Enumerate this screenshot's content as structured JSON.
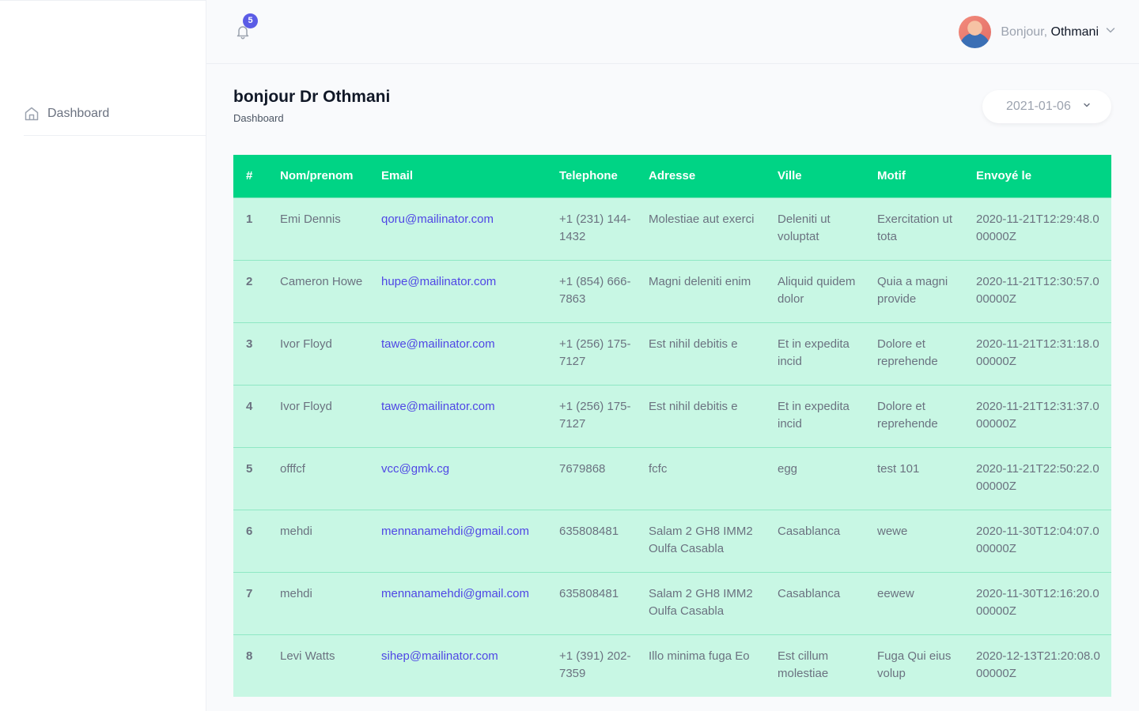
{
  "sidebar": {
    "items": [
      {
        "label": "Dashboard",
        "icon": "home-icon"
      }
    ]
  },
  "topbar": {
    "notification_count": "5",
    "greeting": "Bonjour,",
    "user_name": "Othmani"
  },
  "page": {
    "title": "bonjour Dr Othmani",
    "breadcrumb": "Dashboard",
    "date_filter": "2021-01-06"
  },
  "table": {
    "columns": [
      "#",
      "Nom/prenom",
      "Email",
      "Telephone",
      "Adresse",
      "Ville",
      "Motif",
      "Envoyé le"
    ],
    "rows": [
      [
        "1",
        "Emi Dennis",
        "qoru@mailinator.com",
        "+1 (231) 144-1432",
        "Molestiae aut exerci",
        "Deleniti ut voluptat",
        "Exercitation ut tota",
        "2020-11-21T12:29:48.000000Z"
      ],
      [
        "2",
        "Cameron Howe",
        "hupe@mailinator.com",
        "+1 (854) 666-7863",
        "Magni deleniti enim",
        "Aliquid quidem dolor",
        "Quia a magni provide",
        "2020-11-21T12:30:57.000000Z"
      ],
      [
        "3",
        "Ivor Floyd",
        "tawe@mailinator.com",
        "+1 (256) 175-7127",
        "Est nihil debitis e",
        "Et in expedita incid",
        "Dolore et reprehende",
        "2020-11-21T12:31:18.000000Z"
      ],
      [
        "4",
        "Ivor Floyd",
        "tawe@mailinator.com",
        "+1 (256) 175-7127",
        "Est nihil debitis e",
        "Et in expedita incid",
        "Dolore et reprehende",
        "2020-11-21T12:31:37.000000Z"
      ],
      [
        "5",
        "offfcf",
        "vcc@gmk.cg",
        "7679868",
        "fcfc",
        "egg",
        "test 101",
        "2020-11-21T22:50:22.000000Z"
      ],
      [
        "6",
        "mehdi",
        "mennanamehdi@gmail.com",
        "635808481",
        "Salam 2 GH8 IMM2 Oulfa Casabla",
        "Casablanca",
        "wewe",
        "2020-11-30T12:04:07.000000Z"
      ],
      [
        "7",
        "mehdi",
        "mennanamehdi@gmail.com",
        "635808481",
        "Salam 2 GH8 IMM2 Oulfa Casabla",
        "Casablanca",
        "eewew",
        "2020-11-30T12:16:20.000000Z"
      ],
      [
        "8",
        "Levi Watts",
        "sihep@mailinator.com",
        "+1 (391) 202-7359",
        "Illo minima fuga Eo",
        "Est cillum molestiae",
        "Fuga Qui eius volup",
        "2020-12-13T21:20:08.000000Z"
      ]
    ]
  },
  "colors": {
    "header_green": "#00d485",
    "row_mint": "#c8f7e4",
    "link_indigo": "#4f46e5",
    "badge_indigo": "#5b5ce6"
  }
}
